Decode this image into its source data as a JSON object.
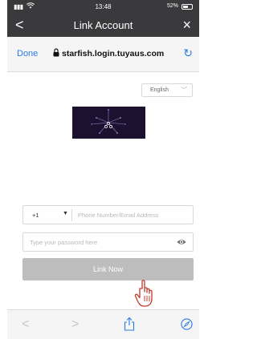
{
  "status_bar": {
    "time": "13:48",
    "battery": "52%"
  },
  "nav": {
    "back": "<",
    "title": "Link Account",
    "close": "×"
  },
  "browser": {
    "done_label": "Done",
    "url": "starfish.login.tuyaus.com",
    "reload_icon": "refresh-icon"
  },
  "language": {
    "selected": "English"
  },
  "form": {
    "country_code": "+1",
    "phone_placeholder": "Phone Number/Email Address",
    "password_placeholder": "Type your password here",
    "link_button": "Link Now"
  },
  "toolbar": {
    "back": "<",
    "forward": ">"
  },
  "colors": {
    "header_bg": "#3a3a3c",
    "accent": "#2c7be5",
    "button_disabled": "#bdbdbd"
  }
}
